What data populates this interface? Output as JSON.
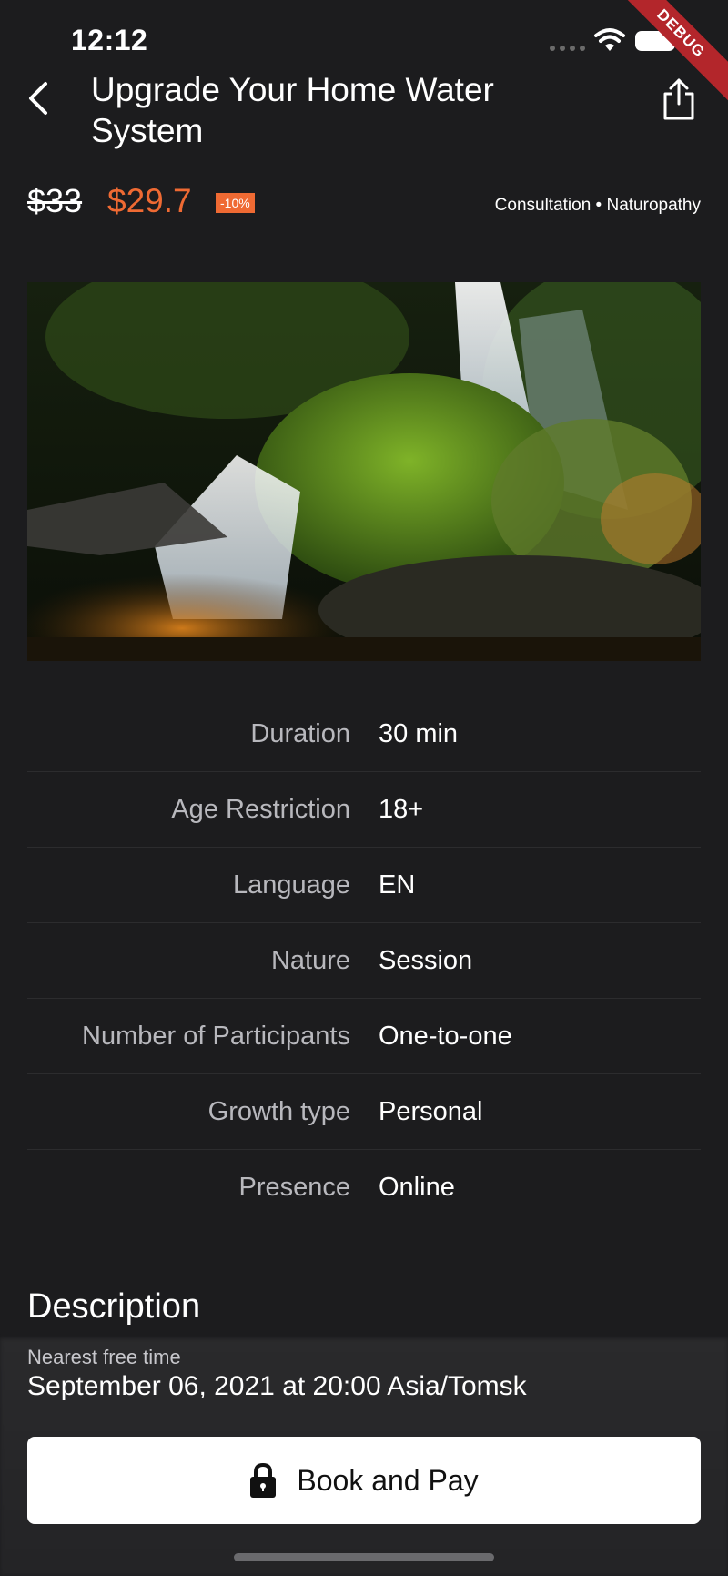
{
  "status_bar": {
    "time": "12:12",
    "debug_label": "DEBUG"
  },
  "header": {
    "title": "Upgrade Your Home Water System",
    "back_icon": "chevron-left-icon",
    "share_icon": "share-icon"
  },
  "price": {
    "old": "$33",
    "new": "$29.7",
    "discount": "-10%",
    "category": "Consultation • Naturopathy"
  },
  "colors": {
    "accent": "#ef6a33",
    "background": "#1c1c1e",
    "divider": "#2c2c2e",
    "debug": "#b3262b"
  },
  "hero_image": {
    "description": "mossy waterfall"
  },
  "specs": [
    {
      "label": "Duration",
      "value": "30 min"
    },
    {
      "label": "Age Restriction",
      "value": "18+"
    },
    {
      "label": "Language",
      "value": "EN"
    },
    {
      "label": "Nature",
      "value": "Session"
    },
    {
      "label": "Number of Participants",
      "value": "One-to-one"
    },
    {
      "label": "Growth type",
      "value": "Personal"
    },
    {
      "label": "Presence",
      "value": "Online"
    }
  ],
  "description": {
    "title": "Description"
  },
  "booking": {
    "nearest_label": "Nearest free time",
    "nearest_value": "September 06, 2021 at 20:00 Asia/Tomsk",
    "button_label": "Book and Pay",
    "button_icon": "lock-icon"
  }
}
